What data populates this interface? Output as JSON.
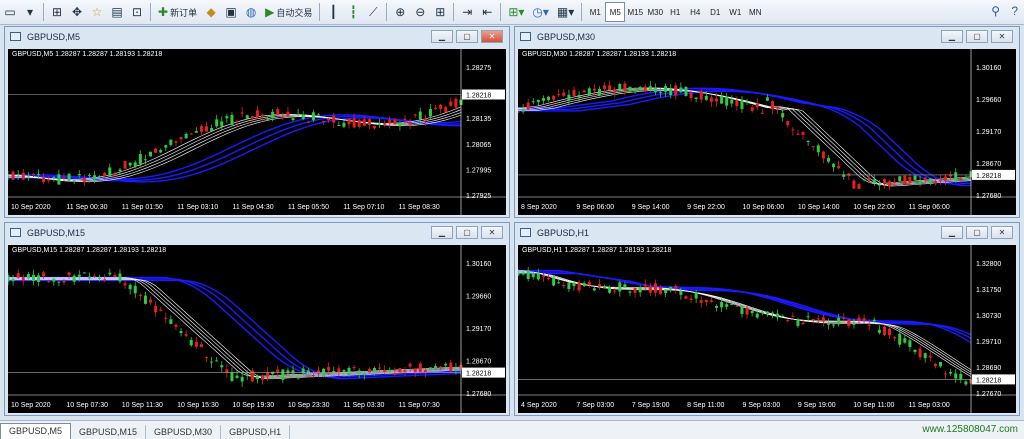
{
  "toolbar": {
    "new_order": "新订单",
    "auto_trading": "自动交易",
    "timeframes": [
      "M1",
      "M5",
      "M15",
      "M30",
      "H1",
      "H4",
      "D1",
      "W1",
      "MN"
    ],
    "active_timeframe": "M5"
  },
  "windows": [
    {
      "title": "GBPUSD,M5",
      "header": "GBPUSD,M5  1.28287 1.28287 1.28193 1.28218",
      "active": true,
      "price_labels": [
        "1.28275",
        "1.28205",
        "1.28135",
        "1.28065",
        "1.27995",
        "1.27925"
      ],
      "current_price": "1.28218",
      "time_labels": [
        "10 Sep 2020",
        "11 Sep 00:30",
        "11 Sep 01:50",
        "11 Sep 03:10",
        "11 Sep 04:30",
        "11 Sep 05:50",
        "11 Sep 07:10",
        "11 Sep 08:30"
      ],
      "trend": "up"
    },
    {
      "title": "GBPUSD,M30",
      "header": "GBPUSD,M30  1.28287 1.28287 1.28193 1.28218",
      "active": false,
      "price_labels": [
        "1.30160",
        "1.29660",
        "1.29170",
        "1.28670",
        "1.27680"
      ],
      "current_price": "1.28218",
      "time_labels": [
        "8 Sep 2020",
        "9 Sep 06:00",
        "9 Sep 14:00",
        "9 Sep 22:00",
        "10 Sep 06:00",
        "10 Sep 14:00",
        "10 Sep 22:00",
        "11 Sep 06:00"
      ],
      "trend": "down"
    },
    {
      "title": "GBPUSD,M15",
      "header": "GBPUSD,M15  1.28287 1.28287 1.28193 1.28218",
      "active": false,
      "price_labels": [
        "1.30160",
        "1.29660",
        "1.29170",
        "1.28670",
        "1.27680"
      ],
      "current_price": "1.28218",
      "time_labels": [
        "10 Sep 2020",
        "10 Sep 07:30",
        "10 Sep 11:30",
        "10 Sep 15:30",
        "10 Sep 19:30",
        "10 Sep 23:30",
        "11 Sep 03:30",
        "11 Sep 07:30"
      ],
      "trend": "down"
    },
    {
      "title": "GBPUSD,H1",
      "header": "GBPUSD,H1  1.28287 1.28287 1.28193 1.28218",
      "active": false,
      "price_labels": [
        "1.32800",
        "1.31750",
        "1.30730",
        "1.29710",
        "1.28690",
        "1.27670"
      ],
      "current_price": "1.28218",
      "time_labels": [
        "4 Sep 2020",
        "7 Sep 03:00",
        "7 Sep 19:00",
        "8 Sep 11:00",
        "9 Sep 03:00",
        "9 Sep 19:00",
        "10 Sep 11:00",
        "11 Sep 03:00"
      ],
      "trend": "down"
    }
  ],
  "tabs": [
    "GBPUSD,M5",
    "GBPUSD,M15",
    "GBPUSD,M30",
    "GBPUSD,H1"
  ],
  "website": "www.125808047.com",
  "colors": {
    "bull": "#2ecc40",
    "bear": "#e8201a",
    "ma_white": "#ffffff",
    "ma_blue": "#1a1aff",
    "chart_bg": "#000000"
  }
}
